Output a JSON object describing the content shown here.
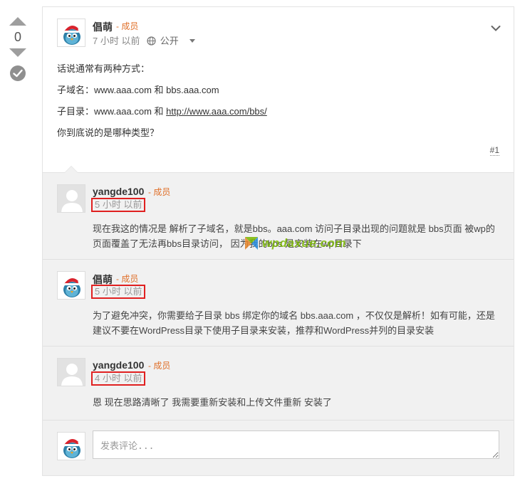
{
  "vote": {
    "count": "0"
  },
  "post": {
    "author": "倡萌",
    "role": "- 成员",
    "time": "7 小时 以前",
    "visibility": "公开",
    "lines": [
      "话说通常有两种方式：",
      "子域名：www.aaa.com  和 bbs.aaa.com",
      "子目录：www.aaa.com 和 "
    ],
    "link": "http://www.aaa.com/bbs/",
    "last_line": "你到底说的是哪种类型？",
    "number": "#1"
  },
  "comments": [
    {
      "author": "yangde100",
      "role": "- 成员",
      "time": "5 小时 以前",
      "text": "现在我这的情况是 解析了子域名，就是bbs。aaa.com 访问子目录出现的问题就是 bbs页面 被wp的页面覆盖了无法再bbs目录访问， 因为我的bbs 是安装在wp目录下"
    },
    {
      "author": "倡萌",
      "role": "- 成员",
      "time": "5 小时 以前",
      "text": "为了避免冲突，你需要给子目录 bbs 绑定你的域名 bbs.aaa.com ，不仅仅是解析！如有可能，还是建议不要在WordPress目录下使用子目录来安装，推荐和WordPress并列的目录安装"
    },
    {
      "author": "yangde100",
      "role": "- 成员",
      "time": "4 小时 以前",
      "text": "恩 现在思路清晰了 我需要重新安装和上传文件重新 安装了"
    }
  ],
  "reply": {
    "placeholder": "发表评论..."
  },
  "watermark": {
    "text": "wpdaxue",
    "cn": ".com"
  },
  "colors": {
    "role": "#e0702a",
    "highlight": "#e02020",
    "watermark": "#7ab800"
  }
}
